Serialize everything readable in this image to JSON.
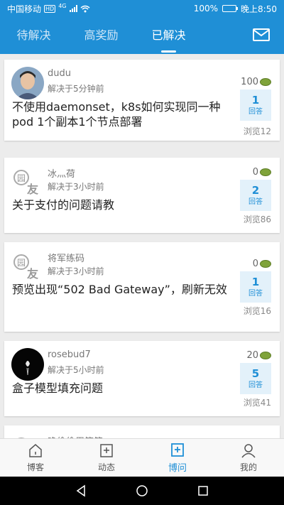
{
  "statusbar": {
    "carrier": "中国移动",
    "hd": "HD",
    "net": "4G",
    "battery": "100%",
    "time": "晚上8:50"
  },
  "tabs": [
    {
      "label": "待解决"
    },
    {
      "label": "高奖励"
    },
    {
      "label": "已解决"
    }
  ],
  "questions": [
    {
      "user": "dudu",
      "solved": "解决于5分钟前",
      "title": "不使用daemonset，k8s如何实现同一种 pod 1个副本1个节点部署",
      "bounty": "100",
      "answers": "1",
      "answers_label": "回答",
      "views": "浏览12"
    },
    {
      "user": "冰灬荷",
      "solved": "解决于3小时前",
      "title": "关于支付的问题请教",
      "bounty": "0",
      "answers": "2",
      "answers_label": "回答",
      "views": "浏览86"
    },
    {
      "user": "将军练码",
      "solved": "解决于3小时前",
      "title": "预览出现“502 Bad Gateway”，刷新无效",
      "bounty": "0",
      "answers": "1",
      "answers_label": "回答",
      "views": "浏览16"
    },
    {
      "user": "rosebud7",
      "solved": "解决于5小时前",
      "title": "盒子模型填充问题",
      "bounty": "20",
      "answers": "5",
      "answers_label": "回答",
      "views": "浏览41"
    },
    {
      "user": "晚偷偷用笑简"
    }
  ],
  "default_avatar_text": {
    "top": "园",
    "bottom": "友"
  },
  "bottomnav": [
    {
      "label": "博客"
    },
    {
      "label": "动态"
    },
    {
      "label": "博问"
    },
    {
      "label": "我的"
    }
  ],
  "colors": {
    "primary": "#1f8fd6",
    "background": "#ececec"
  }
}
